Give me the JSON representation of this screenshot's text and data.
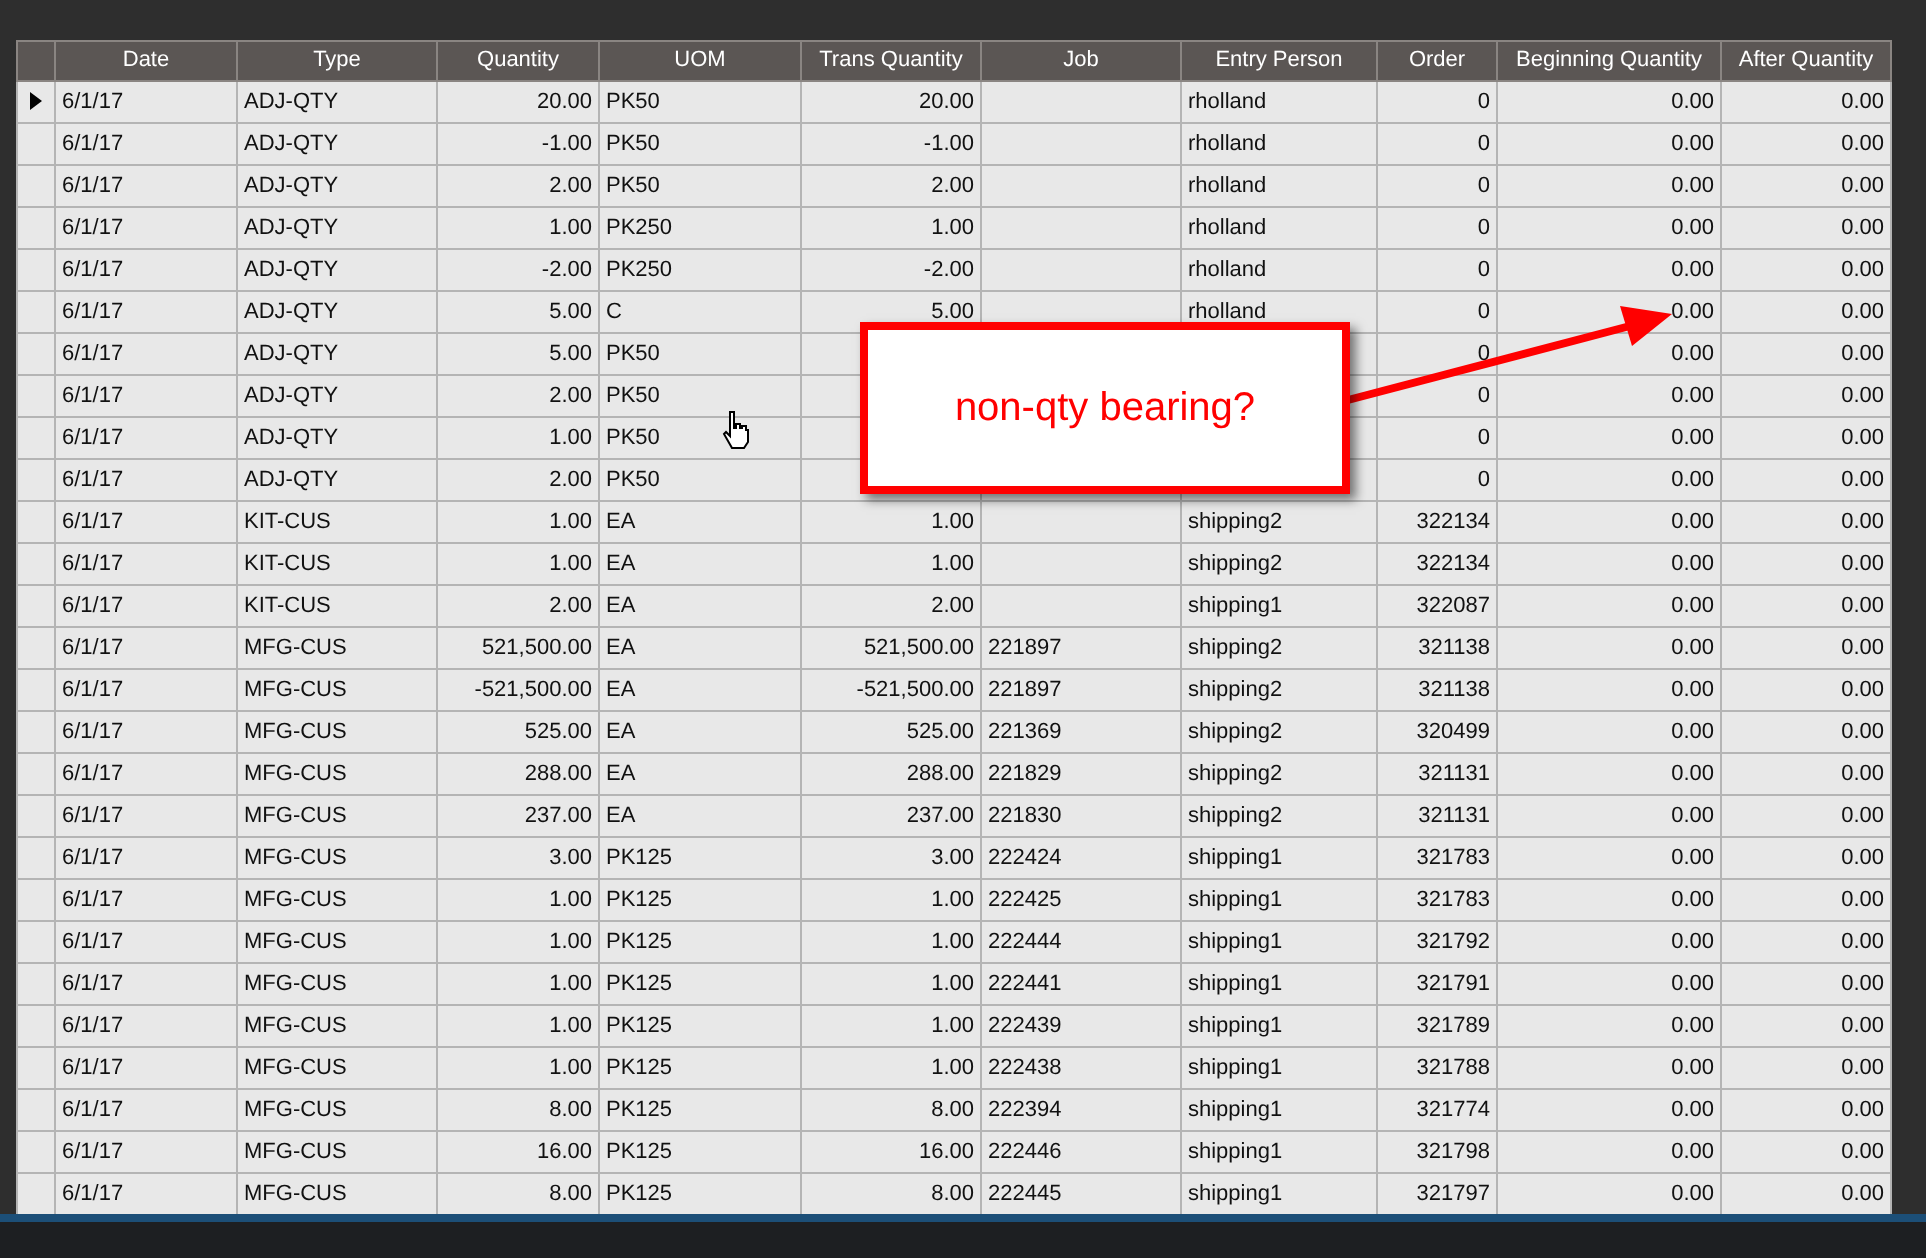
{
  "grid": {
    "columns": [
      {
        "label": "Date",
        "kind": "text"
      },
      {
        "label": "Type",
        "kind": "text"
      },
      {
        "label": "Quantity",
        "kind": "number"
      },
      {
        "label": "UOM",
        "kind": "text"
      },
      {
        "label": "Trans Quantity",
        "kind": "number"
      },
      {
        "label": "Job",
        "kind": "text"
      },
      {
        "label": "Entry Person",
        "kind": "text"
      },
      {
        "label": "Order",
        "kind": "number"
      },
      {
        "label": "Beginning Quantity",
        "kind": "number"
      },
      {
        "label": "After Quantity",
        "kind": "number"
      }
    ],
    "rows": [
      {
        "current": true,
        "cells": [
          "6/1/17",
          "ADJ-QTY",
          "20.00",
          "PK50",
          "20.00",
          null,
          "rholland",
          "0",
          "0.00",
          "0.00"
        ]
      },
      {
        "current": false,
        "cells": [
          "6/1/17",
          "ADJ-QTY",
          "-1.00",
          "PK50",
          "-1.00",
          null,
          "rholland",
          "0",
          "0.00",
          "0.00"
        ]
      },
      {
        "current": false,
        "cells": [
          "6/1/17",
          "ADJ-QTY",
          "2.00",
          "PK50",
          "2.00",
          null,
          "rholland",
          "0",
          "0.00",
          "0.00"
        ]
      },
      {
        "current": false,
        "cells": [
          "6/1/17",
          "ADJ-QTY",
          "1.00",
          "PK250",
          "1.00",
          null,
          "rholland",
          "0",
          "0.00",
          "0.00"
        ]
      },
      {
        "current": false,
        "cells": [
          "6/1/17",
          "ADJ-QTY",
          "-2.00",
          "PK250",
          "-2.00",
          null,
          "rholland",
          "0",
          "0.00",
          "0.00"
        ]
      },
      {
        "current": false,
        "cells": [
          "6/1/17",
          "ADJ-QTY",
          "5.00",
          "C",
          "5.00",
          null,
          "rholland",
          "0",
          "0.00",
          "0.00"
        ]
      },
      {
        "current": false,
        "cells": [
          "6/1/17",
          "ADJ-QTY",
          "5.00",
          "PK50",
          null,
          null,
          null,
          "0",
          "0.00",
          "0.00"
        ]
      },
      {
        "current": false,
        "cells": [
          "6/1/17",
          "ADJ-QTY",
          "2.00",
          "PK50",
          null,
          null,
          null,
          "0",
          "0.00",
          "0.00"
        ]
      },
      {
        "current": false,
        "cells": [
          "6/1/17",
          "ADJ-QTY",
          "1.00",
          "PK50",
          null,
          null,
          null,
          "0",
          "0.00",
          "0.00"
        ]
      },
      {
        "current": false,
        "cells": [
          "6/1/17",
          "ADJ-QTY",
          "2.00",
          "PK50",
          null,
          null,
          null,
          "0",
          "0.00",
          "0.00"
        ]
      },
      {
        "current": false,
        "cells": [
          "6/1/17",
          "KIT-CUS",
          "1.00",
          "EA",
          "1.00",
          null,
          "shipping2",
          "322134",
          "0.00",
          "0.00"
        ]
      },
      {
        "current": false,
        "cells": [
          "6/1/17",
          "KIT-CUS",
          "1.00",
          "EA",
          "1.00",
          null,
          "shipping2",
          "322134",
          "0.00",
          "0.00"
        ]
      },
      {
        "current": false,
        "cells": [
          "6/1/17",
          "KIT-CUS",
          "2.00",
          "EA",
          "2.00",
          null,
          "shipping1",
          "322087",
          "0.00",
          "0.00"
        ]
      },
      {
        "current": false,
        "cells": [
          "6/1/17",
          "MFG-CUS",
          "521,500.00",
          "EA",
          "521,500.00",
          "221897",
          "shipping2",
          "321138",
          "0.00",
          "0.00"
        ]
      },
      {
        "current": false,
        "cells": [
          "6/1/17",
          "MFG-CUS",
          "-521,500.00",
          "EA",
          "-521,500.00",
          "221897",
          "shipping2",
          "321138",
          "0.00",
          "0.00"
        ]
      },
      {
        "current": false,
        "cells": [
          "6/1/17",
          "MFG-CUS",
          "525.00",
          "EA",
          "525.00",
          "221369",
          "shipping2",
          "320499",
          "0.00",
          "0.00"
        ]
      },
      {
        "current": false,
        "cells": [
          "6/1/17",
          "MFG-CUS",
          "288.00",
          "EA",
          "288.00",
          "221829",
          "shipping2",
          "321131",
          "0.00",
          "0.00"
        ]
      },
      {
        "current": false,
        "cells": [
          "6/1/17",
          "MFG-CUS",
          "237.00",
          "EA",
          "237.00",
          "221830",
          "shipping2",
          "321131",
          "0.00",
          "0.00"
        ]
      },
      {
        "current": false,
        "cells": [
          "6/1/17",
          "MFG-CUS",
          "3.00",
          "PK125",
          "3.00",
          "222424",
          "shipping1",
          "321783",
          "0.00",
          "0.00"
        ]
      },
      {
        "current": false,
        "cells": [
          "6/1/17",
          "MFG-CUS",
          "1.00",
          "PK125",
          "1.00",
          "222425",
          "shipping1",
          "321783",
          "0.00",
          "0.00"
        ]
      },
      {
        "current": false,
        "cells": [
          "6/1/17",
          "MFG-CUS",
          "1.00",
          "PK125",
          "1.00",
          "222444",
          "shipping1",
          "321792",
          "0.00",
          "0.00"
        ]
      },
      {
        "current": false,
        "cells": [
          "6/1/17",
          "MFG-CUS",
          "1.00",
          "PK125",
          "1.00",
          "222441",
          "shipping1",
          "321791",
          "0.00",
          "0.00"
        ]
      },
      {
        "current": false,
        "cells": [
          "6/1/17",
          "MFG-CUS",
          "1.00",
          "PK125",
          "1.00",
          "222439",
          "shipping1",
          "321789",
          "0.00",
          "0.00"
        ]
      },
      {
        "current": false,
        "cells": [
          "6/1/17",
          "MFG-CUS",
          "1.00",
          "PK125",
          "1.00",
          "222438",
          "shipping1",
          "321788",
          "0.00",
          "0.00"
        ]
      },
      {
        "current": false,
        "cells": [
          "6/1/17",
          "MFG-CUS",
          "8.00",
          "PK125",
          "8.00",
          "222394",
          "shipping1",
          "321774",
          "0.00",
          "0.00"
        ]
      },
      {
        "current": false,
        "cells": [
          "6/1/17",
          "MFG-CUS",
          "16.00",
          "PK125",
          "16.00",
          "222446",
          "shipping1",
          "321798",
          "0.00",
          "0.00"
        ]
      },
      {
        "current": false,
        "cells": [
          "6/1/17",
          "MFG-CUS",
          "8.00",
          "PK125",
          "8.00",
          "222445",
          "shipping1",
          "321797",
          "0.00",
          "0.00"
        ]
      }
    ]
  },
  "callout": {
    "text": "non-qty bearing?"
  }
}
